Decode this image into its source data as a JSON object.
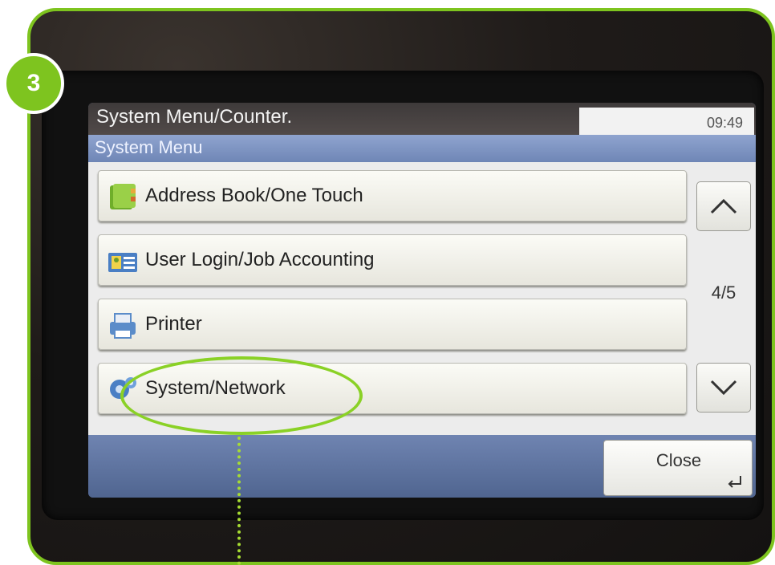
{
  "step_badge": "3",
  "header": {
    "title": "System Menu/Counter.",
    "time": "09:49"
  },
  "subheader": {
    "title": "System Menu"
  },
  "menu": {
    "items": [
      {
        "label": "Address Book/One Touch",
        "icon": "address-book-icon"
      },
      {
        "label": "User Login/Job Accounting",
        "icon": "user-login-icon"
      },
      {
        "label": "Printer",
        "icon": "printer-icon"
      },
      {
        "label": "System/Network",
        "icon": "system-network-icon",
        "highlighted": true
      }
    ]
  },
  "pager": {
    "indicator": "4/5",
    "up_icon": "chevron-up-icon",
    "down_icon": "chevron-down-icon"
  },
  "footer": {
    "close_label": "Close",
    "close_icon": "enter-icon"
  },
  "colors": {
    "highlight": "#8ad126",
    "frame": "#7ec41f"
  }
}
